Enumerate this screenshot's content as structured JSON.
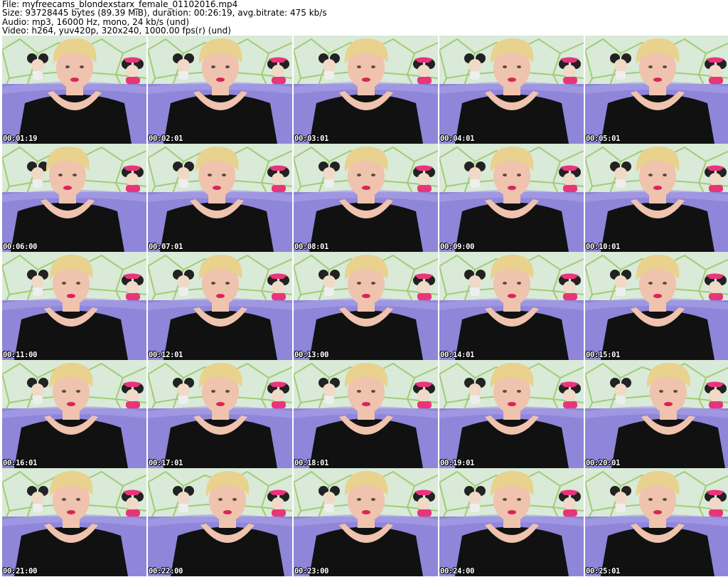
{
  "header": {
    "file_line": "File: myfreecams_blondexstarx_female_01102016.mp4",
    "size_line": "Size: 93728445 bytes (89.39 MiB), duration: 00:26:19, avg.bitrate: 475 kb/s",
    "audio_line": "Audio: mp3, 16000 Hz, mono, 24 kb/s (und)",
    "video_line": "Video: h264, yuv420p, 320x240, 1000.00 fps(r) (und)"
  },
  "thumbnails": [
    {
      "timestamp": "00:01:19"
    },
    {
      "timestamp": "00:02:01"
    },
    {
      "timestamp": "00:03:01"
    },
    {
      "timestamp": "00:04:01"
    },
    {
      "timestamp": "00:05:01"
    },
    {
      "timestamp": "00:06:00"
    },
    {
      "timestamp": "00:07:01"
    },
    {
      "timestamp": "00:08:01"
    },
    {
      "timestamp": "00:09:00"
    },
    {
      "timestamp": "00:10:01"
    },
    {
      "timestamp": "00:11:00"
    },
    {
      "timestamp": "00:12:01"
    },
    {
      "timestamp": "00:13:00"
    },
    {
      "timestamp": "00:14:01"
    },
    {
      "timestamp": "00:15:01"
    },
    {
      "timestamp": "00:16:01"
    },
    {
      "timestamp": "00:17:01"
    },
    {
      "timestamp": "00:18:01"
    },
    {
      "timestamp": "00:19:01"
    },
    {
      "timestamp": "00:20:01"
    },
    {
      "timestamp": "00:21:00"
    },
    {
      "timestamp": "00:22:00"
    },
    {
      "timestamp": "00:23:00"
    },
    {
      "timestamp": "00:24:00"
    },
    {
      "timestamp": "00:25:01"
    }
  ],
  "colors": {
    "wall": "#d9ead8",
    "wall_lines": "#9cc96a",
    "sofa": "#8f86d9",
    "shirt": "#111111",
    "skin": "#efc3ad",
    "hair": "#e8d28e",
    "lips": "#d8245a",
    "toy_pink": "#e8357a"
  }
}
